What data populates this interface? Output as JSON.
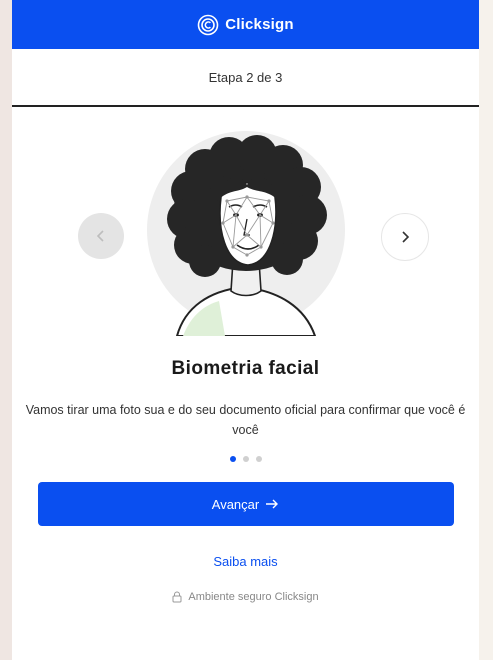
{
  "header": {
    "brand": "Clicksign",
    "logo_icon": "clicksign-logo-icon"
  },
  "progress": {
    "step_label": "Etapa 2 de 3",
    "current": 2,
    "total": 3
  },
  "carousel": {
    "prev_icon": "chevron-left-icon",
    "next_icon": "chevron-right-icon",
    "illustration": "face-biometrics-illustration",
    "active_index": 0,
    "dot_count": 3
  },
  "content": {
    "title": "Biometria facial",
    "description": "Vamos tirar uma foto sua e do seu documento oficial para confirmar que você é você"
  },
  "actions": {
    "primary_label": "Avançar",
    "primary_icon": "arrow-right-icon",
    "link_label": "Saiba mais"
  },
  "footer": {
    "secure_label": "Ambiente seguro Clicksign",
    "lock_icon": "lock-icon"
  },
  "colors": {
    "brand": "#0a4ff0",
    "text": "#333333"
  }
}
